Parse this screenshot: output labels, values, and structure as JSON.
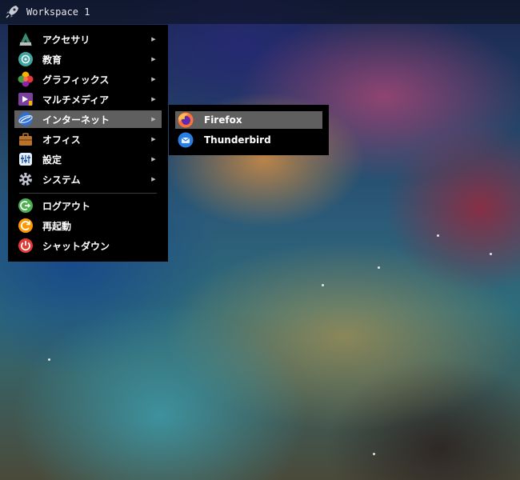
{
  "taskbar": {
    "launcher_icon": "rocket-icon",
    "workspace_label": "Workspace 1"
  },
  "menu": {
    "items": [
      {
        "label": "アクセサリ",
        "icon": "accessories-icon",
        "has_submenu": true
      },
      {
        "label": "教育",
        "icon": "education-icon",
        "has_submenu": true
      },
      {
        "label": "グラフィックス",
        "icon": "graphics-icon",
        "has_submenu": true
      },
      {
        "label": "マルチメディア",
        "icon": "multimedia-icon",
        "has_submenu": true
      },
      {
        "label": "インターネット",
        "icon": "internet-icon",
        "has_submenu": true,
        "active": true
      },
      {
        "label": "オフィス",
        "icon": "office-icon",
        "has_submenu": true
      },
      {
        "label": "設定",
        "icon": "settings-icon",
        "has_submenu": true
      },
      {
        "label": "システム",
        "icon": "system-icon",
        "has_submenu": true
      }
    ],
    "actions": [
      {
        "label": "ログアウト",
        "icon": "logout-icon"
      },
      {
        "label": "再起動",
        "icon": "reboot-icon"
      },
      {
        "label": "シャットダウン",
        "icon": "shutdown-icon"
      }
    ]
  },
  "submenu": {
    "items": [
      {
        "label": "Firefox",
        "icon": "firefox-icon",
        "active": true
      },
      {
        "label": "Thunderbird",
        "icon": "thunderbird-icon"
      }
    ]
  },
  "colors": {
    "menu_bg": "#000000",
    "highlight": "#5f5f5f",
    "logout_green": "#4caf50",
    "reboot_orange": "#ff9800",
    "shutdown_red": "#e53935"
  }
}
